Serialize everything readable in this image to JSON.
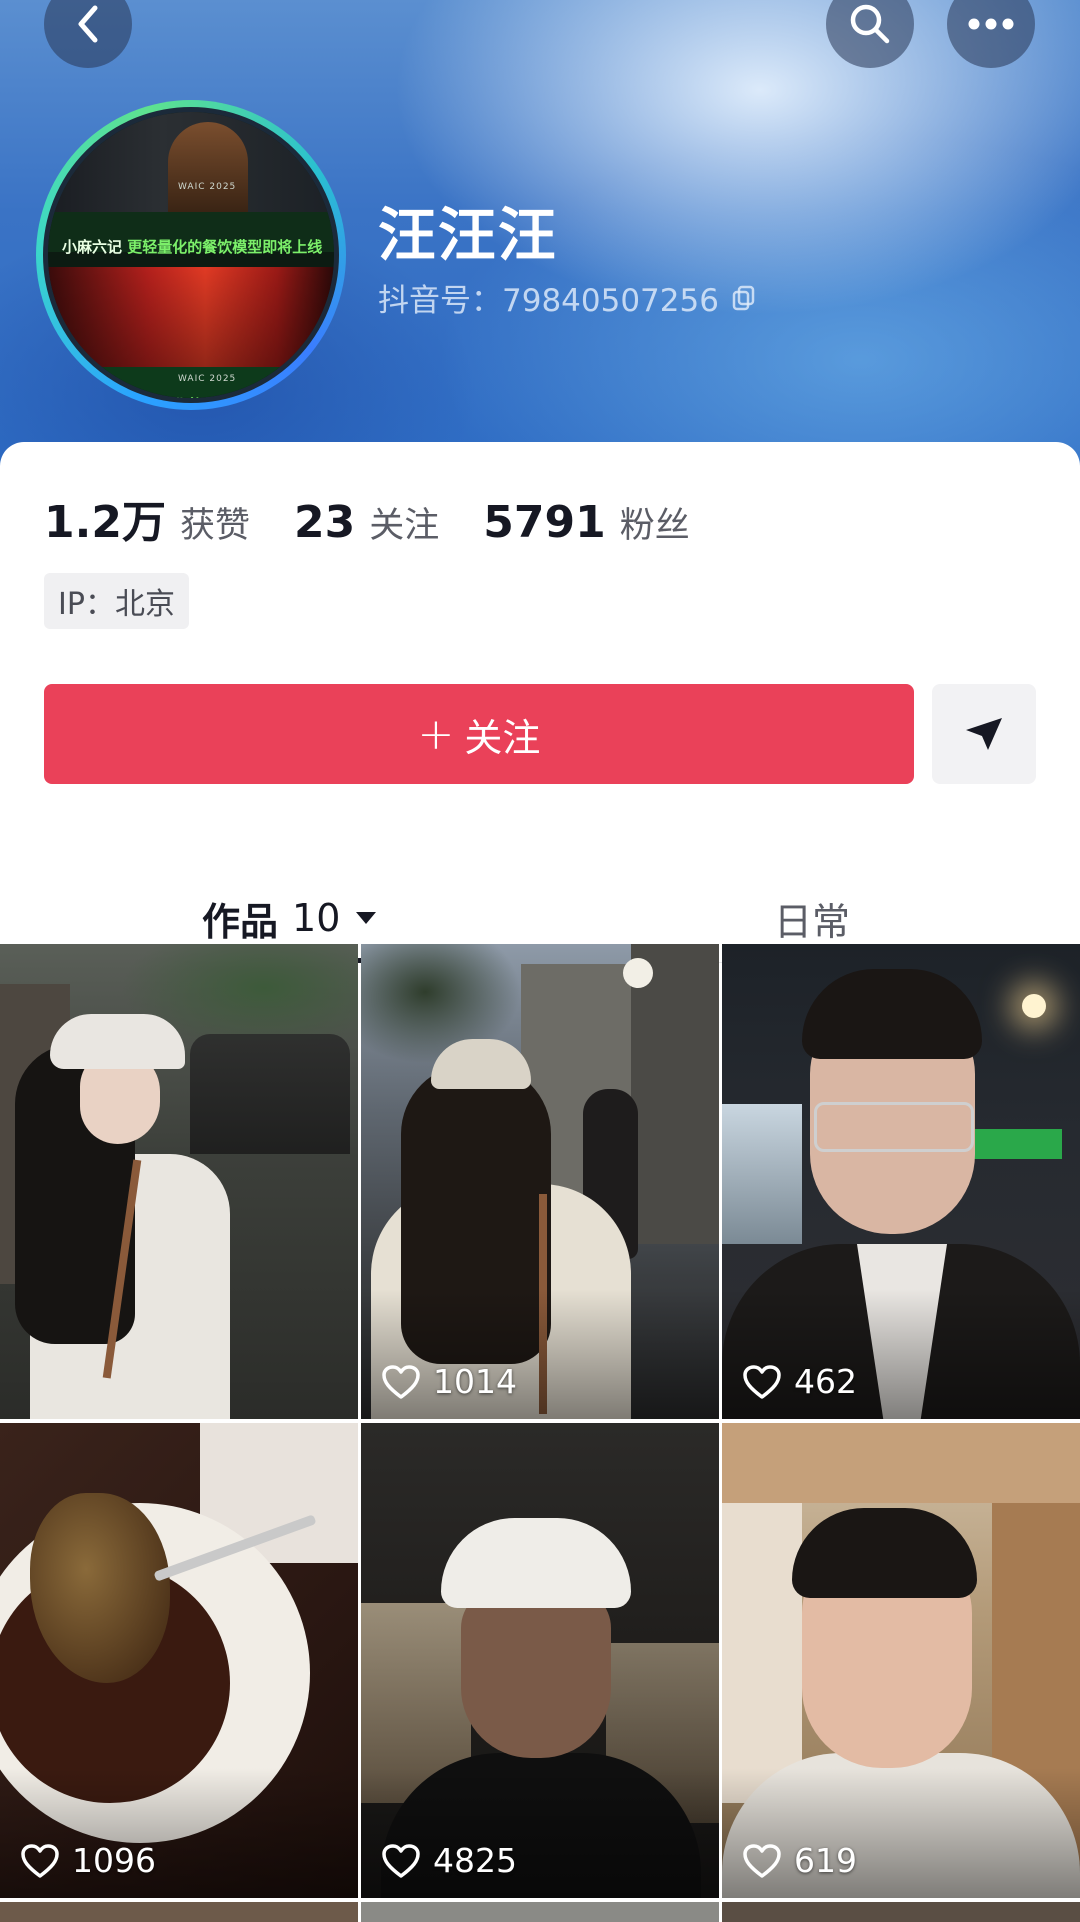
{
  "header": {
    "profile_name": "汪汪汪",
    "profile_id": "抖音号：79840507256",
    "avatar": {
      "line1_prefix": "小麻六记",
      "line1_highlight": "更轻量化的餐饮模型即将上线",
      "line2": "更轻量化的餐饮",
      "tag": "WAIC 2025"
    }
  },
  "stats": [
    {
      "value": "1.2万",
      "label": "获赞"
    },
    {
      "value": "23",
      "label": "关注"
    },
    {
      "value": "5791",
      "label": "粉丝"
    }
  ],
  "ip_label": "IP：北京",
  "actions": {
    "follow_plus": "+",
    "follow_label": "关注"
  },
  "tabs": {
    "works_label": "作品",
    "works_count": "10",
    "daily_label": "日常"
  },
  "videos": [
    {
      "likes": ""
    },
    {
      "likes": "1014"
    },
    {
      "likes": "462"
    },
    {
      "likes": "1096"
    },
    {
      "likes": "4825"
    },
    {
      "likes": "619"
    }
  ],
  "colors": {
    "follow_button": "#ea4159",
    "header_blue": "#3a73c5",
    "text_primary": "#161823",
    "text_secondary": "#5b5d66"
  },
  "icons": [
    "back-icon",
    "search-icon",
    "more-icon",
    "copy-icon",
    "share-icon",
    "caret-down-icon",
    "heart-icon"
  ]
}
